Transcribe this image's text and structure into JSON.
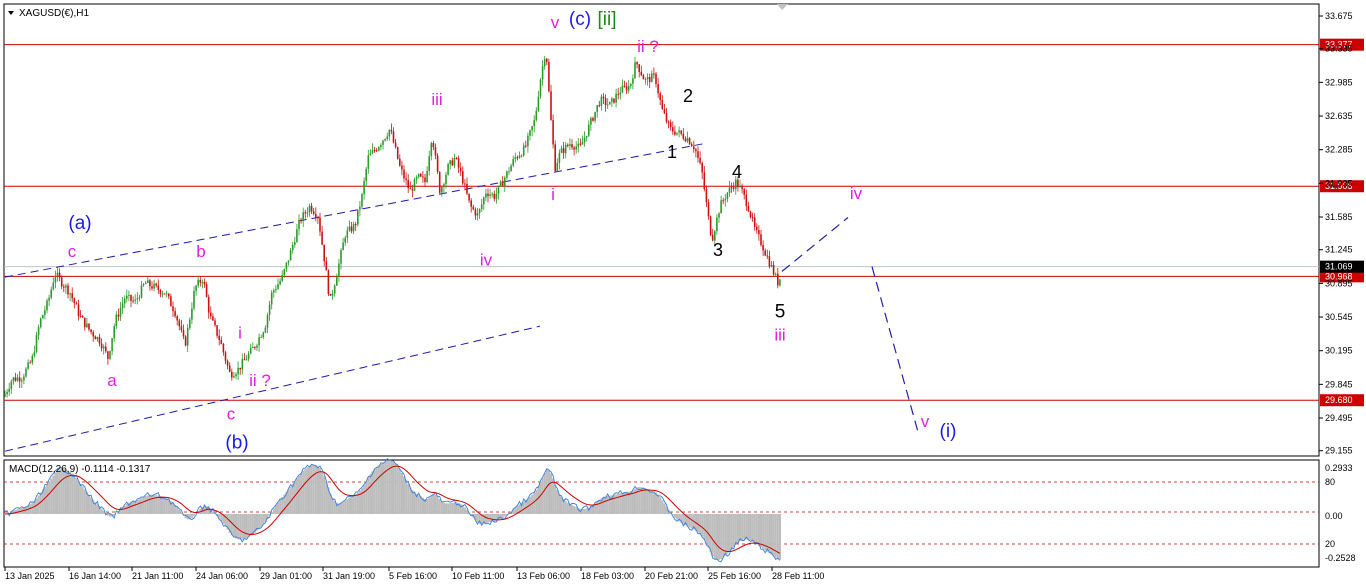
{
  "chart_data": {
    "type": "candlestick",
    "symbol": "XAGUSD(€),H1",
    "y_ticks": [
      "33.675",
      "33.335",
      "32.985",
      "32.635",
      "32.285",
      "31.935",
      "31.585",
      "31.245",
      "30.895",
      "30.545",
      "30.195",
      "29.845",
      "29.495",
      "29.155"
    ],
    "ylim": [
      29.1,
      33.8
    ],
    "x_ticks": [
      "13 Jan 2025",
      "16 Jan 14:00",
      "21 Jan 11:00",
      "24 Jan 06:00",
      "29 Jan 01:00",
      "31 Jan 19:00",
      "5 Feb 16:00",
      "10 Feb 11:00",
      "13 Feb 06:00",
      "18 Feb 03:00",
      "20 Feb 21:00",
      "25 Feb 16:00",
      "28 Feb 11:00"
    ],
    "price_lines": [
      {
        "value": 33.377,
        "label": "33.377",
        "color": "#cc0000"
      },
      {
        "value": 31.905,
        "label": "31.905",
        "color": "#cc0000"
      },
      {
        "value": 30.968,
        "label": "30.968",
        "color": "#cc0000"
      },
      {
        "value": 29.68,
        "label": "29.680",
        "color": "#cc0000"
      }
    ],
    "current_price": {
      "value": 31.069,
      "label": "31.069"
    },
    "price_path": [
      [
        0,
        29.6
      ],
      [
        4,
        29.72
      ],
      [
        12,
        29.9
      ],
      [
        22,
        29.92
      ],
      [
        32,
        30.1
      ],
      [
        40,
        30.5
      ],
      [
        48,
        30.7
      ],
      [
        55,
        31.0
      ],
      [
        62,
        30.9
      ],
      [
        70,
        30.8
      ],
      [
        80,
        30.55
      ],
      [
        90,
        30.4
      ],
      [
        100,
        30.3
      ],
      [
        108,
        30.12
      ],
      [
        115,
        30.5
      ],
      [
        125,
        30.75
      ],
      [
        135,
        30.7
      ],
      [
        145,
        30.9
      ],
      [
        155,
        30.85
      ],
      [
        165,
        30.8
      ],
      [
        175,
        30.6
      ],
      [
        185,
        30.25
      ],
      [
        195,
        30.85
      ],
      [
        203,
        30.95
      ],
      [
        210,
        30.55
      ],
      [
        220,
        30.3
      ],
      [
        230,
        29.95
      ],
      [
        238,
        30.0
      ],
      [
        245,
        30.1
      ],
      [
        255,
        30.25
      ],
      [
        265,
        30.45
      ],
      [
        272,
        30.8
      ],
      [
        282,
        30.95
      ],
      [
        290,
        31.2
      ],
      [
        300,
        31.55
      ],
      [
        310,
        31.7
      ],
      [
        318,
        31.6
      ],
      [
        325,
        31.1
      ],
      [
        330,
        30.7
      ],
      [
        338,
        31.05
      ],
      [
        345,
        31.4
      ],
      [
        355,
        31.5
      ],
      [
        362,
        31.8
      ],
      [
        368,
        32.2
      ],
      [
        380,
        32.35
      ],
      [
        390,
        32.5
      ],
      [
        400,
        32.1
      ],
      [
        410,
        31.85
      ],
      [
        418,
        32.0
      ],
      [
        425,
        31.95
      ],
      [
        432,
        32.45
      ],
      [
        440,
        31.85
      ],
      [
        448,
        32.1
      ],
      [
        455,
        32.2
      ],
      [
        462,
        32.0
      ],
      [
        470,
        31.7
      ],
      [
        478,
        31.6
      ],
      [
        486,
        31.85
      ],
      [
        495,
        31.8
      ],
      [
        505,
        32.0
      ],
      [
        515,
        32.2
      ],
      [
        525,
        32.3
      ],
      [
        535,
        32.6
      ],
      [
        540,
        33.0
      ],
      [
        546,
        33.35
      ],
      [
        550,
        32.7
      ],
      [
        555,
        32.1
      ],
      [
        560,
        32.25
      ],
      [
        570,
        32.35
      ],
      [
        580,
        32.3
      ],
      [
        590,
        32.55
      ],
      [
        600,
        32.8
      ],
      [
        610,
        32.75
      ],
      [
        620,
        32.9
      ],
      [
        630,
        32.95
      ],
      [
        636,
        33.2
      ],
      [
        645,
        33.0
      ],
      [
        655,
        33.05
      ],
      [
        662,
        32.7
      ],
      [
        670,
        32.5
      ],
      [
        680,
        32.45
      ],
      [
        688,
        32.4
      ],
      [
        695,
        32.3
      ],
      [
        702,
        32.05
      ],
      [
        708,
        31.6
      ],
      [
        712,
        31.35
      ],
      [
        720,
        31.7
      ],
      [
        728,
        31.85
      ],
      [
        736,
        31.95
      ],
      [
        742,
        31.85
      ],
      [
        748,
        31.7
      ],
      [
        755,
        31.45
      ],
      [
        762,
        31.3
      ],
      [
        770,
        31.1
      ],
      [
        778,
        30.9
      ],
      [
        784,
        31.05
      ]
    ],
    "channel_lines": [
      {
        "from": [
          5,
          30.96
        ],
        "to": [
          705,
          32.35
        ],
        "color": "#1a1aaa"
      },
      {
        "from": [
          5,
          29.15
        ],
        "to": [
          540,
          30.45
        ],
        "color": "#1a1aaa"
      }
    ],
    "projection": {
      "points": [
        [
          782,
          31.02
        ],
        [
          848,
          31.58
        ],
        null,
        [
          872,
          31.07
        ],
        [
          918,
          29.35
        ]
      ],
      "color": "#2222aa"
    },
    "wave_labels": [
      {
        "text": "v",
        "x": 555,
        "y": 33.55,
        "color": "#e020e0",
        "size": 17
      },
      {
        "text": "(c)",
        "x": 580,
        "y": 33.58,
        "color": "#1a1aee",
        "size": 19
      },
      {
        "text": "[ii]",
        "x": 607,
        "y": 33.58,
        "color": "#1a8a1a",
        "size": 19
      },
      {
        "text": "ii ?",
        "x": 648,
        "y": 33.3,
        "color": "#e020e0",
        "size": 17
      },
      {
        "text": "2",
        "x": 688,
        "y": 32.78,
        "color": "#000000",
        "size": 18
      },
      {
        "text": "1",
        "x": 672,
        "y": 32.2,
        "color": "#000000",
        "size": 18
      },
      {
        "text": "4",
        "x": 737,
        "y": 31.99,
        "color": "#000000",
        "size": 18
      },
      {
        "text": "3",
        "x": 718,
        "y": 31.18,
        "color": "#000000",
        "size": 18
      },
      {
        "text": "5",
        "x": 780,
        "y": 30.54,
        "color": "#000000",
        "size": 19
      },
      {
        "text": "iii",
        "x": 780,
        "y": 30.3,
        "color": "#e020e0",
        "size": 17
      },
      {
        "text": "iv",
        "x": 856,
        "y": 31.77,
        "color": "#e020e0",
        "size": 17
      },
      {
        "text": "v",
        "x": 925,
        "y": 29.4,
        "color": "#e020e0",
        "size": 17
      },
      {
        "text": "(i)",
        "x": 948,
        "y": 29.3,
        "color": "#1a1aee",
        "size": 19
      },
      {
        "text": "iii",
        "x": 437,
        "y": 32.75,
        "color": "#e020e0",
        "size": 17
      },
      {
        "text": "i",
        "x": 553,
        "y": 31.76,
        "color": "#e020e0",
        "size": 17
      },
      {
        "text": "iv",
        "x": 486,
        "y": 31.08,
        "color": "#e020e0",
        "size": 17
      },
      {
        "text": "(a)",
        "x": 80,
        "y": 31.46,
        "color": "#1a1aee",
        "size": 19
      },
      {
        "text": "c",
        "x": 72,
        "y": 31.17,
        "color": "#e020e0",
        "size": 17
      },
      {
        "text": "b",
        "x": 201,
        "y": 31.17,
        "color": "#e020e0",
        "size": 17
      },
      {
        "text": "a",
        "x": 112,
        "y": 29.83,
        "color": "#e020e0",
        "size": 17
      },
      {
        "text": "i",
        "x": 240,
        "y": 30.32,
        "color": "#e020e0",
        "size": 17
      },
      {
        "text": "ii ?",
        "x": 260,
        "y": 29.83,
        "color": "#e020e0",
        "size": 17
      },
      {
        "text": "c",
        "x": 231,
        "y": 29.48,
        "color": "#e020e0",
        "size": 17
      },
      {
        "text": "(b)",
        "x": 237,
        "y": 29.18,
        "color": "#1a1aee",
        "size": 19
      }
    ],
    "macd": {
      "label": "MACD(12,26,9) -0.1114 -0.1317",
      "y_ticks": [
        "0.2933",
        "80",
        "0.00",
        "20",
        "-0.2528"
      ],
      "levels": {
        "upper": 80,
        "middle": 50,
        "lower": 20
      }
    }
  }
}
